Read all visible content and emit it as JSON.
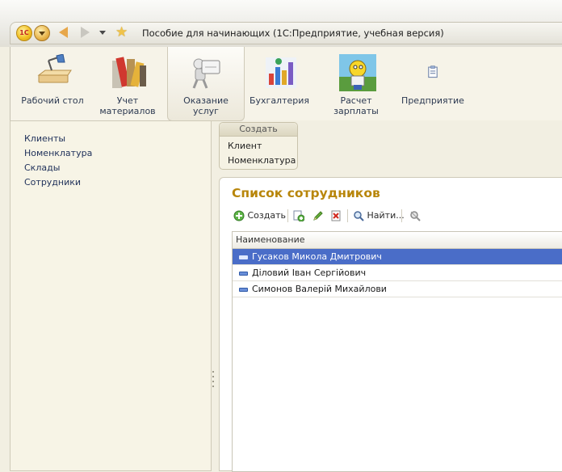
{
  "window": {
    "title": "Пособие для начинающих  (1С:Предприятие, учебная версия)"
  },
  "sections": [
    {
      "label": "Рабочий стол",
      "icon": "desk-lamp-icon"
    },
    {
      "label": "Учет материалов",
      "icon": "materials-icon"
    },
    {
      "label": "Оказание услуг",
      "icon": "services-icon"
    },
    {
      "label": "Бухгалтерия",
      "icon": "accounting-icon"
    },
    {
      "label": "Расчет зарплаты",
      "icon": "payroll-icon"
    },
    {
      "label": "Предприятие",
      "icon": "enterprise-icon"
    }
  ],
  "nav": {
    "items": [
      "Клиенты",
      "Номенклатура",
      "Склады",
      "Сотрудники"
    ]
  },
  "create_panel": {
    "header": "Создать",
    "items": [
      "Клиент",
      "Номенклатура"
    ]
  },
  "form": {
    "title": "Список сотрудников",
    "toolbar": {
      "create": "Создать",
      "find": "Найти..."
    },
    "column_header": "Наименование",
    "rows": [
      "Гусаков Микола Дмитрович",
      "Діловий Іван Сергійович",
      "Симонов Валерій Михайлови"
    ]
  },
  "colors": {
    "accent_title": "#b8860b",
    "selected_row": "#4a6dc8"
  }
}
